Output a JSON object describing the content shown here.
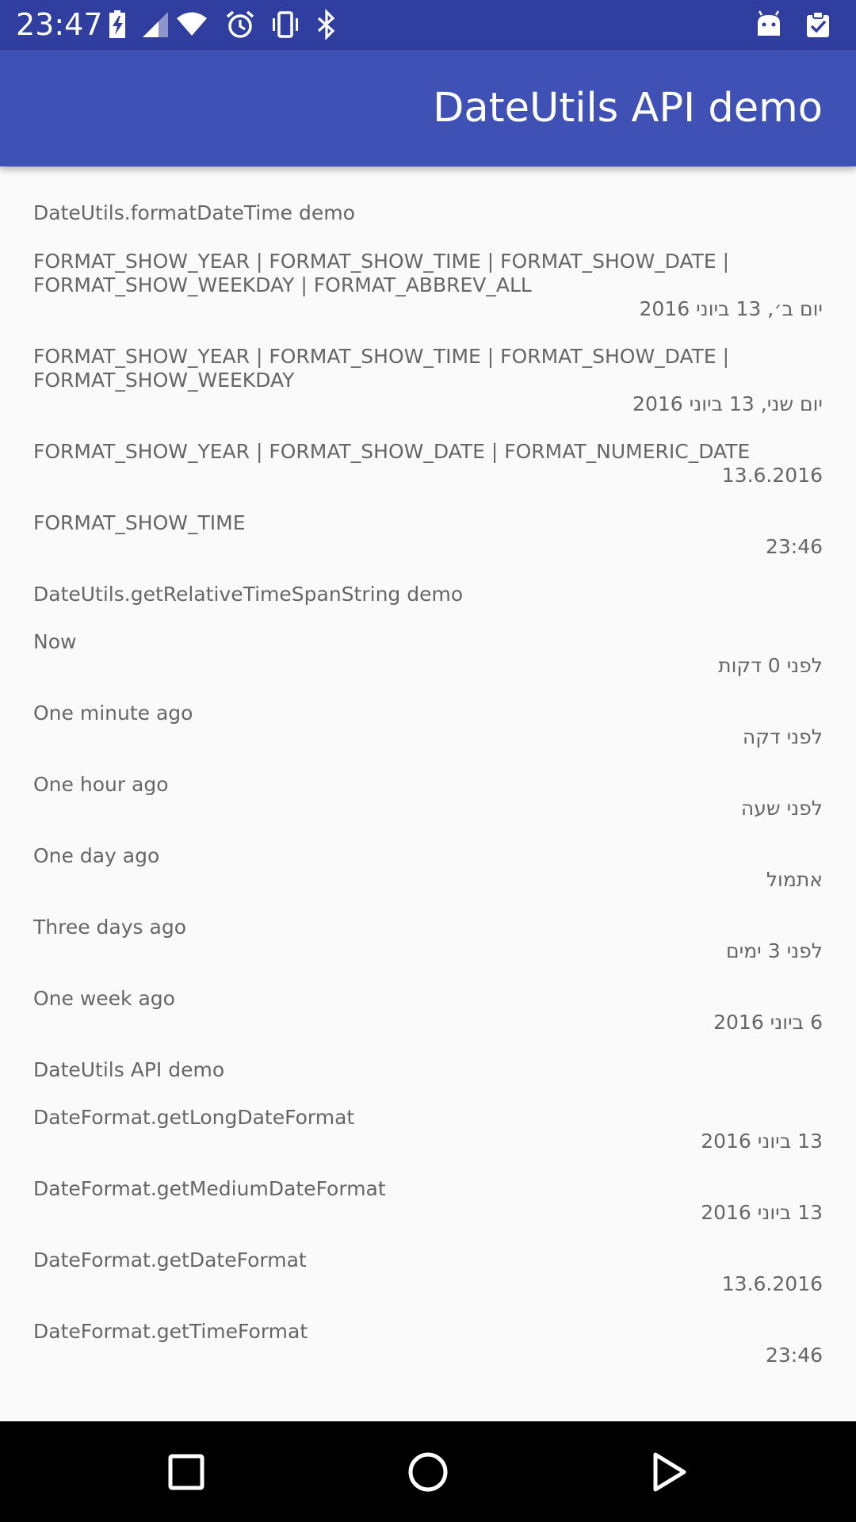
{
  "status_bar": {
    "time": "23:47",
    "icons": [
      "battery-charging-icon",
      "signal-icon",
      "wifi-icon",
      "alarm-icon",
      "vibrate-icon",
      "bluetooth-icon",
      "android-icon",
      "clipboard-check-icon"
    ]
  },
  "app_bar": {
    "title": "DateUtils API demo",
    "color": "#3f51b5",
    "status_color": "#303f9f"
  },
  "content": {
    "section_format_datetime": "DateUtils.formatDateTime demo",
    "fmt1_label_l1": "FORMAT_SHOW_YEAR | FORMAT_SHOW_TIME | FORMAT_SHOW_DATE |",
    "fmt1_label_l2": "FORMAT_SHOW_WEEKDAY | FORMAT_ABBREV_ALL",
    "fmt1_value": "יום ב׳, 13 ביוני 2016",
    "fmt2_label_l1": "FORMAT_SHOW_YEAR | FORMAT_SHOW_TIME | FORMAT_SHOW_DATE |",
    "fmt2_label_l2": "FORMAT_SHOW_WEEKDAY",
    "fmt2_value": "יום שני, 13 ביוני 2016",
    "fmt3_label": "FORMAT_SHOW_YEAR | FORMAT_SHOW_DATE | FORMAT_NUMERIC_DATE",
    "fmt3_value": "13.6.2016",
    "fmt4_label": "FORMAT_SHOW_TIME",
    "fmt4_value": "23:46",
    "section_relative": "DateUtils.getRelativeTimeSpanString demo",
    "rel_now_label": "Now",
    "rel_now_value": "לפני 0 דקות",
    "rel_minute_label": "One minute ago",
    "rel_minute_value": "לפני דקה",
    "rel_hour_label": "One hour ago",
    "rel_hour_value": "לפני שעה",
    "rel_day_label": "One day ago",
    "rel_day_value": "אתמול",
    "rel_3days_label": "Three days ago",
    "rel_3days_value": "לפני 3 ימים",
    "rel_week_label": "One week ago",
    "rel_week_value": "6 ביוני 2016",
    "section_api": "DateUtils API demo",
    "df_long_label": "DateFormat.getLongDateFormat",
    "df_long_value": "13 ביוני 2016",
    "df_medium_label": "DateFormat.getMediumDateFormat",
    "df_medium_value": "13 ביוני 2016",
    "df_date_label": "DateFormat.getDateFormat",
    "df_date_value": "13.6.2016",
    "df_time_label": "DateFormat.getTimeFormat",
    "df_time_value": "23:46"
  },
  "nav_bar": {
    "buttons": [
      "recents-square-icon",
      "home-circle-icon",
      "back-triangle-icon"
    ]
  }
}
